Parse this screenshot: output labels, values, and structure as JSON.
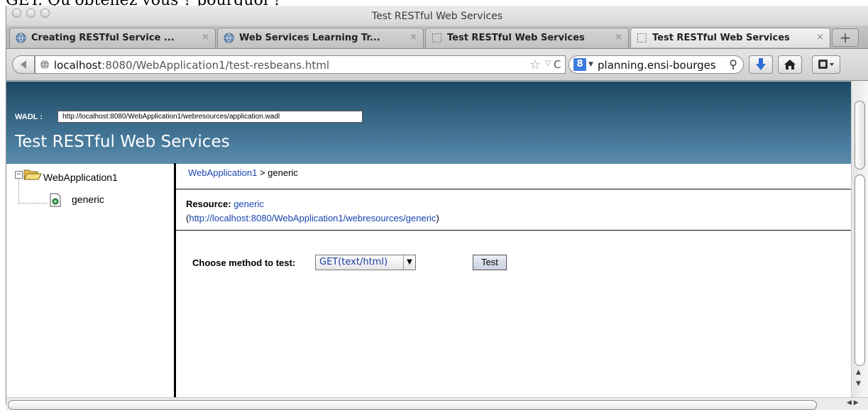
{
  "document": {
    "cut_text": "GET. Qu'obtenez vous ? pourquoi ?"
  },
  "window": {
    "title": "Test RESTful Web Services"
  },
  "tabs": [
    {
      "label": "Creating RESTful Service ...",
      "icon": "globe-icon"
    },
    {
      "label": "Web Services Learning Tr...",
      "icon": "globe-icon"
    },
    {
      "label": "Test RESTful Web Services",
      "icon": "blank-page-icon"
    },
    {
      "label": "Test RESTful Web Services",
      "icon": "blank-page-icon",
      "active": true
    }
  ],
  "tab_close": "×",
  "new_tab": "+",
  "navbar": {
    "url_host": "localhost",
    "url_rest": ":8080/WebApplication1/test-resbeans.html",
    "search_engine": "Google",
    "search_text": "planning.ensi-bourges"
  },
  "page": {
    "wadl_label": "WADL :",
    "wadl_url": "http://localhost:8080/WebApplication1/webresources/application.wadl",
    "title": "Test RESTful Web Services"
  },
  "tree": {
    "root": "WebApplication1",
    "child": "generic"
  },
  "main": {
    "breadcrumb_link": "WebApplication1",
    "breadcrumb_rest": " > generic",
    "resource_label": "Resource:",
    "resource_name": "generic",
    "resource_url": "http://localhost:8080/WebApplication1/webresources/generic",
    "method_label": "Choose method to test:",
    "method_selected": "GET(text/html)",
    "test_button": "Test"
  },
  "colors": {
    "header_top": "#1d4963",
    "header_bottom": "#5d8cab",
    "link": "#1a44b0"
  }
}
